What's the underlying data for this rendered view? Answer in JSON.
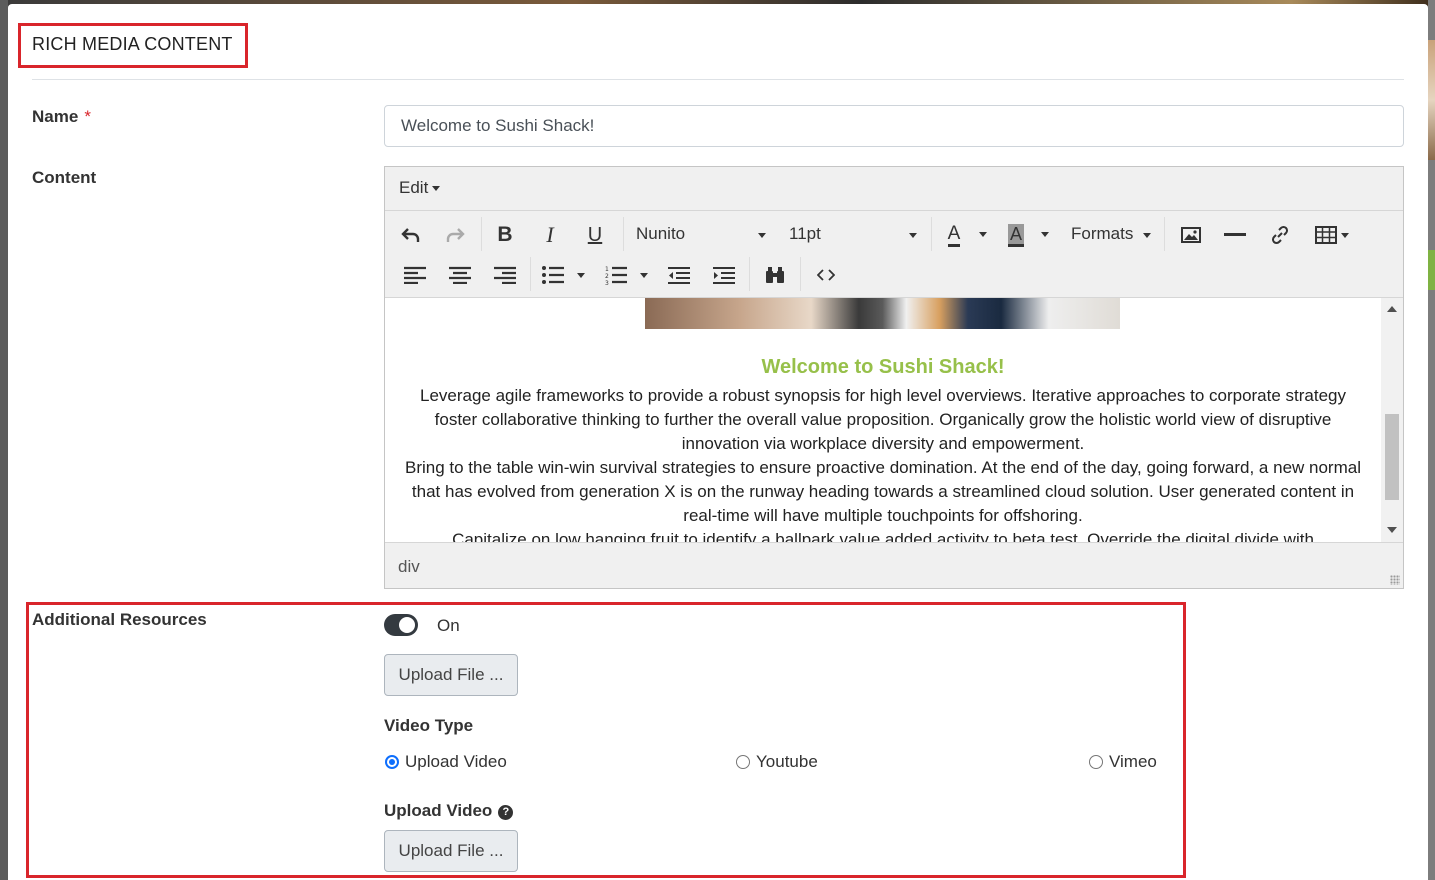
{
  "modal": {
    "title": "RICH MEDIA CONTENT"
  },
  "form": {
    "name_label": "Name",
    "required_marker": "*",
    "name_value": "Welcome to Sushi Shack!",
    "content_label": "Content",
    "additional_resources_label": "Additional Resources"
  },
  "editor": {
    "menu_edit": "Edit",
    "font_family": "Nunito",
    "font_size": "11pt",
    "formats": "Formats",
    "heading": "Welcome to Sushi Shack!",
    "heading_color": "#97c04a",
    "paragraphs": [
      "Leverage agile frameworks to provide a robust synopsis for high level overviews. Iterative approaches to corporate strategy foster collaborative thinking to further the overall value proposition. Organically grow the holistic world view of disruptive innovation via workplace diversity and empowerment.",
      "Bring to the table win-win survival strategies to ensure proactive domination. At the end of the day, going forward, a new normal that has evolved from generation X is on the runway heading towards a streamlined cloud solution. User generated content in real-time will have multiple touchpoints for offshoring.",
      "Capitalize on low hanging fruit to identify a ballpark value added activity to beta test. Override the digital divide with"
    ],
    "status_path": "div",
    "toolbar_icons": [
      "undo-icon",
      "redo-icon",
      "bold-icon",
      "italic-icon",
      "underline-icon",
      "text-color-icon",
      "background-color-icon",
      "image-icon",
      "horizontal-rule-icon",
      "link-icon",
      "table-icon",
      "align-left-icon",
      "align-center-icon",
      "align-right-icon",
      "bullet-list-icon",
      "numbered-list-icon",
      "outdent-icon",
      "indent-icon",
      "find-replace-icon",
      "source-code-icon"
    ]
  },
  "resources": {
    "toggle_state": "On",
    "toggle_on": true,
    "upload_file_label": "Upload File ...",
    "video_type_label": "Video Type",
    "video_options": [
      "Upload Video",
      "Youtube",
      "Vimeo"
    ],
    "selected_video_option": "Upload Video",
    "upload_video_label": "Upload Video",
    "upload_video_button": "Upload File ..."
  },
  "colors": {
    "highlight_border": "#d9252b",
    "radio_selected": "#0d6efd",
    "toggle_bg": "#343a40"
  }
}
